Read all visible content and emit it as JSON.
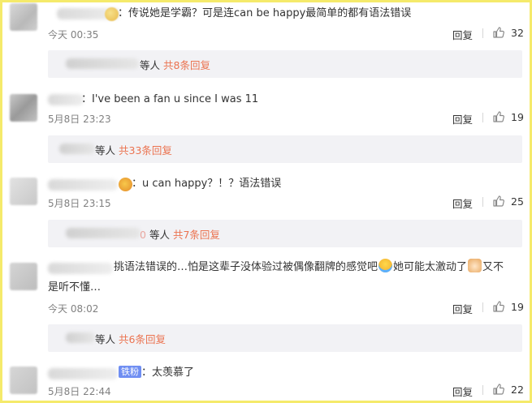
{
  "comments": [
    {
      "name_suffix": "：",
      "text": "传说她是学霸？可是连can be happy最简单的都有语法错误",
      "time": "今天 00:35",
      "reply_label": "回复",
      "likes": "32",
      "replies": {
        "who": "等人",
        "link": "共8条回复"
      }
    },
    {
      "name_suffix": "：",
      "text": "I've been a fan u since I was 11",
      "time": "5月8日 23:23",
      "reply_label": "回复",
      "likes": "19",
      "replies": {
        "who": "等人",
        "link": "共33条回复"
      }
    },
    {
      "name_suffix": "：",
      "text": "u can happy？！？语法错误",
      "time": "5月8日 23:15",
      "reply_label": "回复",
      "likes": "25",
      "replies": {
        "name_tail": "0",
        "who": "等人",
        "link": "共7条回复"
      }
    },
    {
      "text_line1_a": "挑语法错误的…怕是这辈子没体验过被偶像翻牌的感觉吧",
      "text_line1_b": "她可能太激动了",
      "text_line1_c": "又不",
      "text_line2": "是听不懂…",
      "time": "今天 08:02",
      "reply_label": "回复",
      "likes": "19",
      "replies": {
        "who": "等人",
        "link": "共6条回复"
      }
    },
    {
      "badge": "铁粉",
      "name_suffix": "：",
      "text": "太羡慕了",
      "time": "5月8日 22:44",
      "reply_label": "回复",
      "likes": "22"
    }
  ],
  "colors": {
    "accent": "#eb7350",
    "frame": "#f5ea6b",
    "reply_bg": "#f2f2f5"
  },
  "icons": {
    "like": "thumb-up-icon"
  }
}
